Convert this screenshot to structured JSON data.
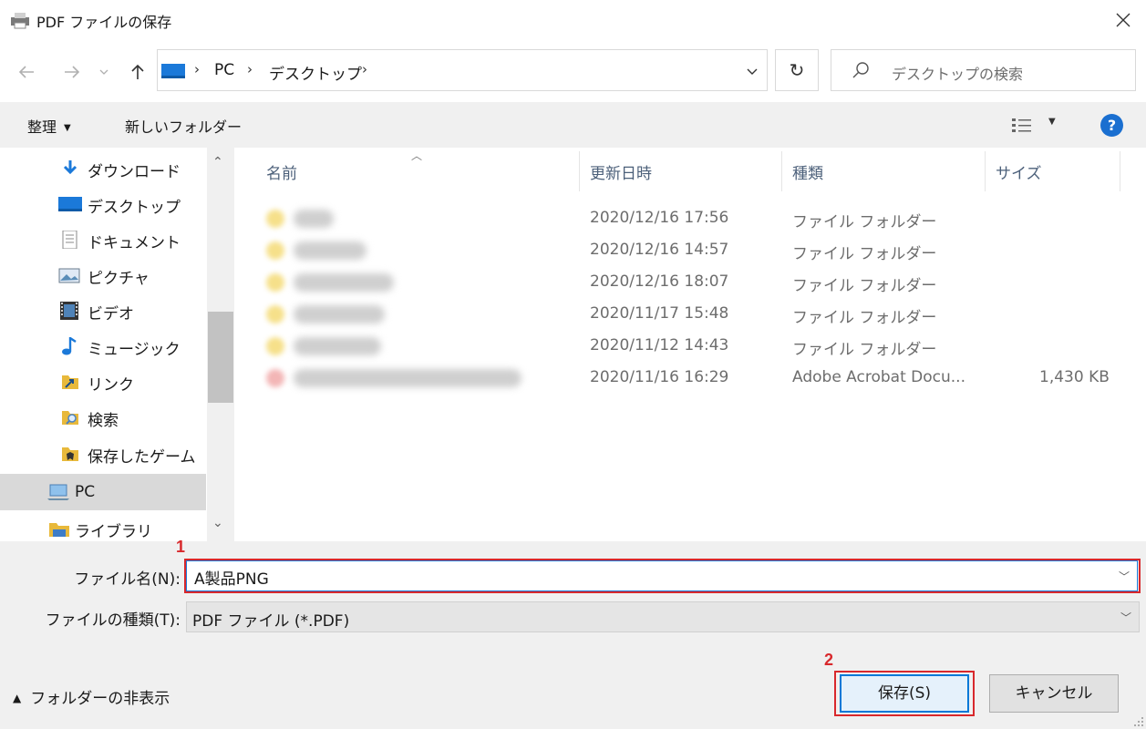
{
  "window": {
    "title": "PDF ファイルの保存"
  },
  "address": {
    "crumbs": [
      "PC",
      "デスクトップ"
    ],
    "search_placeholder": "デスクトップの検索"
  },
  "toolbar": {
    "organize": "整理",
    "new_folder": "新しいフォルダー",
    "help": "?"
  },
  "nav": {
    "items": [
      {
        "label": "ダウンロード",
        "icon": "download-arrow-icon"
      },
      {
        "label": "デスクトップ",
        "icon": "desktop-icon"
      },
      {
        "label": "ドキュメント",
        "icon": "document-icon"
      },
      {
        "label": "ピクチャ",
        "icon": "pictures-icon"
      },
      {
        "label": "ビデオ",
        "icon": "video-icon"
      },
      {
        "label": "ミュージック",
        "icon": "music-note-icon"
      },
      {
        "label": "リンク",
        "icon": "links-folder-icon"
      },
      {
        "label": "検索",
        "icon": "search-folder-icon"
      },
      {
        "label": "保存したゲーム",
        "icon": "saved-games-icon"
      },
      {
        "label": "PC",
        "icon": "pc-icon"
      },
      {
        "label": "ライブラリ",
        "icon": "library-icon"
      }
    ],
    "selected": "PC"
  },
  "columns": {
    "name": "名前",
    "modified": "更新日時",
    "type": "種類",
    "size": "サイズ"
  },
  "files": [
    {
      "date": "2020/12/16 17:56",
      "type": "ファイル フォルダー",
      "size": ""
    },
    {
      "date": "2020/12/16 14:57",
      "type": "ファイル フォルダー",
      "size": ""
    },
    {
      "date": "2020/12/16 18:07",
      "type": "ファイル フォルダー",
      "size": ""
    },
    {
      "date": "2020/11/17 15:48",
      "type": "ファイル フォルダー",
      "size": ""
    },
    {
      "date": "2020/11/12 14:43",
      "type": "ファイル フォルダー",
      "size": ""
    },
    {
      "date": "2020/11/16 16:29",
      "type": "Adobe Acrobat Docu...",
      "size": "1,430 KB"
    }
  ],
  "form": {
    "filename_label": "ファイル名(N):",
    "filename_value": "A製品PNG",
    "filetype_label": "ファイルの種類(T):",
    "filetype_value": "PDF ファイル (*.PDF)"
  },
  "footer": {
    "hide_folders": "フォルダーの非表示",
    "save": "保存(S)",
    "cancel": "キャンセル"
  },
  "annotations": {
    "marker_1": "1",
    "marker_2": "2",
    "color": "#d8282c"
  },
  "colors": {
    "accent": "#0078d7",
    "help": "#1a6fd0"
  }
}
